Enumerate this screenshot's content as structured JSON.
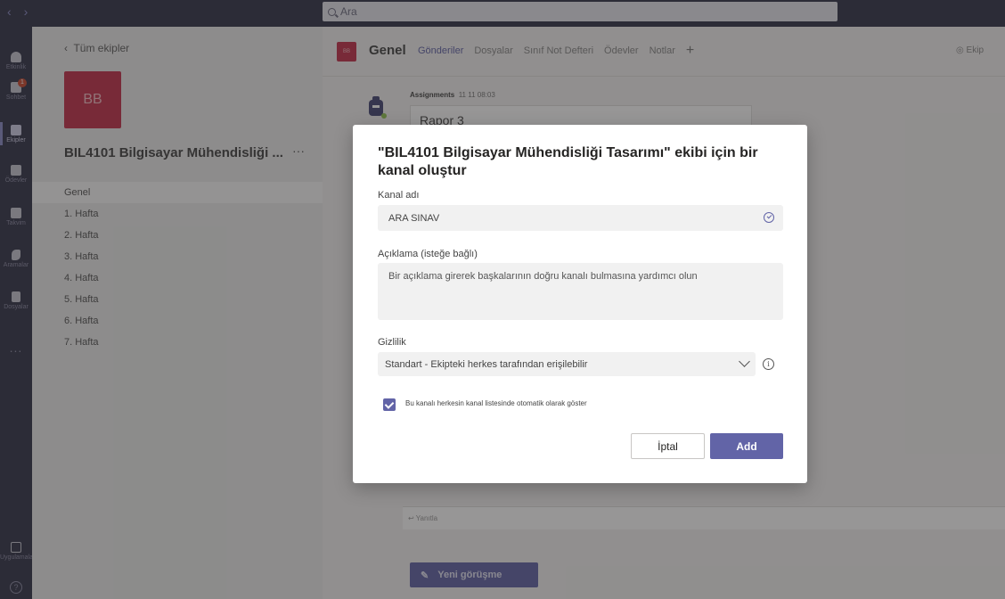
{
  "search": {
    "placeholder": "Ara"
  },
  "appbar": {
    "items": [
      {
        "label": "Etkinlik",
        "icon": "bell-icon"
      },
      {
        "label": "Sohbet",
        "icon": "chat-icon",
        "badge": "1"
      },
      {
        "label": "Ekipler",
        "icon": "teams-icon"
      },
      {
        "label": "Ödevler",
        "icon": "assignments-icon"
      },
      {
        "label": "Takvim",
        "icon": "calendar-icon"
      },
      {
        "label": "Aramalar",
        "icon": "phone-icon"
      },
      {
        "label": "Dosyalar",
        "icon": "files-icon"
      }
    ],
    "more": "...",
    "apps_label": "Uygulamalar",
    "help_label": "?"
  },
  "sidebar": {
    "back_label": "Tüm ekipler",
    "team_initials": "BB",
    "team_name": "BIL4101 Bilgisayar Mühendisliği ...",
    "more": "···",
    "channels": [
      "Genel",
      "1. Hafta",
      "2. Hafta",
      "3. Hafta",
      "4. Hafta",
      "5. Hafta",
      "6. Hafta",
      "7. Hafta"
    ]
  },
  "header": {
    "channel_initials": "BB",
    "channel_name": "Genel",
    "tabs": [
      "Gönderiler",
      "Dosyalar",
      "Sınıf Not Defteri",
      "Ödevler",
      "Notlar"
    ],
    "plus": "+",
    "team_button": "Ekip"
  },
  "feed": {
    "author": "Assignments",
    "timestamp": "11 11 08:03",
    "post_title": "Rapor 3",
    "reply_label": "Yanıtla",
    "new_conversation": "Yeni görüşme"
  },
  "dialog": {
    "title": "\"BIL4101 Bilgisayar Mühendisliği Tasarımı\" ekibi için bir kanal oluştur",
    "name_label": "Kanal adı",
    "name_value": "ARA SINAV",
    "description_label": "Açıklama (isteğe bağlı)",
    "description_placeholder": "Bir açıklama girerek başkalarının doğru kanalı bulmasına yardımcı olun",
    "privacy_label": "Gizlilik",
    "privacy_value": "Standart - Ekipteki herkes tarafından erişilebilir",
    "checkbox_label": "Bu kanalı herkesin kanal listesinde otomatik olarak göster",
    "checkbox_checked": true,
    "cancel_label": "İptal",
    "add_label": "Add"
  },
  "colors": {
    "accent": "#6264a7",
    "team": "#c4314b",
    "appbar": "#33344a"
  }
}
